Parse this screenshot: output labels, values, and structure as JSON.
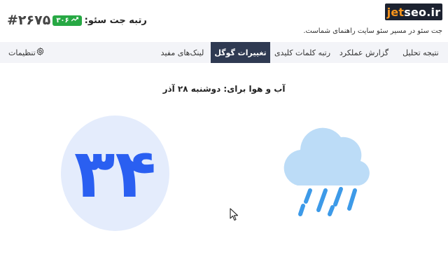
{
  "header": {
    "logo_jet": "jet",
    "logo_seo": "seo.ir",
    "tagline": "جت سئو در مسیر سئو سایت راهنمای شماست.",
    "rank_label": "رتبه جت سئو:",
    "rank_badge": "۳۰۶",
    "rank_value": "#۲۶۷۵"
  },
  "nav": {
    "tabs": [
      {
        "label": "نتیجه تحلیل"
      },
      {
        "label": "گزارش عملکرد"
      },
      {
        "label": "رتبه کلمات کلیدی"
      },
      {
        "label": "تغییرات گوگل"
      },
      {
        "label": "لینک‌های مفید"
      }
    ],
    "settings_label": "تنظیمات"
  },
  "weather": {
    "title": "آب و هوا برای: دوشنبه ۲۸ آذر",
    "temperature": "۳۴",
    "condition_icon": "rain-cloud-icon"
  },
  "colors": {
    "badge_green": "#27a844",
    "nav_active": "#2f3a52",
    "temp_blue": "#2a5ff1",
    "circle_bg": "#e4ecfc",
    "cloud": "#bcdcf7",
    "rain": "#3d9ae8"
  }
}
